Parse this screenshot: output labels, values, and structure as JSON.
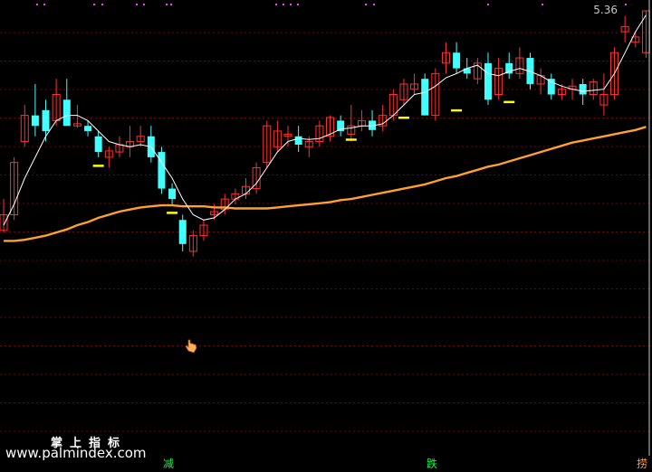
{
  "header": {
    "price_label": "5.36"
  },
  "watermark": {
    "title": "掌上指标",
    "url": "www.palmindex.com"
  },
  "signals": [
    {
      "text": "减",
      "x_index": 14,
      "color": "#00ff40"
    },
    {
      "text": "跌",
      "x_index": 39,
      "color": "#00ff40"
    },
    {
      "text": "捞",
      "x_index": 58,
      "color": "#ffa040"
    }
  ],
  "colors": {
    "up": "#ff3030",
    "down": "#40ffff",
    "ma_short": "#ffffff",
    "ma_long": "#ffa030",
    "marker": "#ffff00",
    "grid": "#7a0000",
    "top_dots": "#ff40ff"
  },
  "chart_data": {
    "type": "candlestick",
    "title": "",
    "xlabel": "",
    "ylabel": "",
    "ylim": [
      2.2,
      5.4
    ],
    "grid": true,
    "candles": [
      [
        3.3,
        3.45,
        3.28,
        3.6
      ],
      [
        3.45,
        3.95,
        3.4,
        4.0
      ],
      [
        4.15,
        4.4,
        4.1,
        4.5
      ],
      [
        4.4,
        4.3,
        4.2,
        4.7
      ],
      [
        4.45,
        4.25,
        4.15,
        4.55
      ],
      [
        4.35,
        4.6,
        4.3,
        4.75
      ],
      [
        4.55,
        4.3,
        4.3,
        4.75
      ],
      [
        4.3,
        4.32,
        4.28,
        4.5
      ],
      [
        4.3,
        4.25,
        4.2,
        4.35
      ],
      [
        4.2,
        4.05,
        4.0,
        4.25
      ],
      [
        4.0,
        4.06,
        3.9,
        4.1
      ],
      [
        4.05,
        4.12,
        4.0,
        4.2
      ],
      [
        4.1,
        4.15,
        4.0,
        4.3
      ],
      [
        4.15,
        4.2,
        4.1,
        4.3
      ],
      [
        4.2,
        4.0,
        3.95,
        4.3
      ],
      [
        4.05,
        3.7,
        3.65,
        4.1
      ],
      [
        3.7,
        3.6,
        3.55,
        3.75
      ],
      [
        3.4,
        3.17,
        3.1,
        3.45
      ],
      [
        3.1,
        3.25,
        3.05,
        3.3
      ],
      [
        3.25,
        3.35,
        3.2,
        3.4
      ],
      [
        3.45,
        3.48,
        3.4,
        3.55
      ],
      [
        3.5,
        3.6,
        3.45,
        3.65
      ],
      [
        3.6,
        3.65,
        3.55,
        3.7
      ],
      [
        3.65,
        3.72,
        3.6,
        3.8
      ],
      [
        3.7,
        3.9,
        3.65,
        3.95
      ],
      [
        3.95,
        4.3,
        3.9,
        4.35
      ],
      [
        4.1,
        4.25,
        4.05,
        4.35
      ],
      [
        4.2,
        4.22,
        4.1,
        4.3
      ],
      [
        4.2,
        4.12,
        4.05,
        4.3
      ],
      [
        4.1,
        4.15,
        4.0,
        4.2
      ],
      [
        4.15,
        4.3,
        4.1,
        4.35
      ],
      [
        4.2,
        4.38,
        4.15,
        4.4
      ],
      [
        4.35,
        4.25,
        4.2,
        4.4
      ],
      [
        4.22,
        4.3,
        4.15,
        4.5
      ],
      [
        4.3,
        4.35,
        4.25,
        4.45
      ],
      [
        4.35,
        4.26,
        4.2,
        4.45
      ],
      [
        4.3,
        4.4,
        4.25,
        4.5
      ],
      [
        4.4,
        4.6,
        4.35,
        4.65
      ],
      [
        4.55,
        4.7,
        4.5,
        4.75
      ],
      [
        4.65,
        4.7,
        4.6,
        4.8
      ],
      [
        4.75,
        4.4,
        4.4,
        4.8
      ],
      [
        4.4,
        4.8,
        4.35,
        4.85
      ],
      [
        4.9,
        5.0,
        4.8,
        5.1
      ],
      [
        5.0,
        4.85,
        4.8,
        5.1
      ],
      [
        4.85,
        4.8,
        4.75,
        4.95
      ],
      [
        4.75,
        4.9,
        4.7,
        4.95
      ],
      [
        4.9,
        4.55,
        4.5,
        5.0
      ],
      [
        4.6,
        4.85,
        4.55,
        4.95
      ],
      [
        4.9,
        4.8,
        4.75,
        5.0
      ],
      [
        4.8,
        4.95,
        4.75,
        5.05
      ],
      [
        4.95,
        4.7,
        4.65,
        5.0
      ],
      [
        4.7,
        4.78,
        4.6,
        4.85
      ],
      [
        4.75,
        4.6,
        4.55,
        4.8
      ],
      [
        4.6,
        4.65,
        4.55,
        4.7
      ],
      [
        4.65,
        4.68,
        4.55,
        4.75
      ],
      [
        4.7,
        4.6,
        4.5,
        4.75
      ],
      [
        4.6,
        4.72,
        4.55,
        4.75
      ],
      [
        4.5,
        4.6,
        4.4,
        4.8
      ],
      [
        4.6,
        5.0,
        4.55,
        5.05
      ],
      [
        5.2,
        5.25,
        5.1,
        5.35
      ],
      [
        5.1,
        5.15,
        5.05,
        5.2
      ],
      [
        5.0,
        5.4,
        4.95,
        5.4
      ]
    ],
    "ma_short": [
      3.35,
      3.55,
      3.8,
      4.0,
      4.2,
      4.35,
      4.4,
      4.4,
      4.35,
      4.25,
      4.15,
      4.12,
      4.1,
      4.12,
      4.1,
      3.95,
      3.8,
      3.6,
      3.45,
      3.4,
      3.42,
      3.5,
      3.6,
      3.65,
      3.75,
      3.9,
      4.05,
      4.15,
      4.18,
      4.17,
      4.18,
      4.22,
      4.27,
      4.28,
      4.3,
      4.3,
      4.32,
      4.4,
      4.5,
      4.6,
      4.62,
      4.68,
      4.76,
      4.8,
      4.85,
      4.88,
      4.8,
      4.78,
      4.82,
      4.85,
      4.82,
      4.78,
      4.72,
      4.68,
      4.65,
      4.63,
      4.64,
      4.65,
      4.8,
      5.0,
      5.2,
      5.36
    ],
    "ma_long": [
      3.2,
      3.2,
      3.21,
      3.23,
      3.25,
      3.28,
      3.31,
      3.35,
      3.38,
      3.42,
      3.45,
      3.48,
      3.5,
      3.52,
      3.53,
      3.54,
      3.54,
      3.53,
      3.53,
      3.53,
      3.52,
      3.52,
      3.51,
      3.51,
      3.51,
      3.51,
      3.52,
      3.53,
      3.54,
      3.55,
      3.56,
      3.57,
      3.59,
      3.6,
      3.62,
      3.64,
      3.66,
      3.68,
      3.7,
      3.72,
      3.74,
      3.77,
      3.8,
      3.82,
      3.85,
      3.88,
      3.91,
      3.93,
      3.96,
      3.99,
      4.02,
      4.05,
      4.08,
      4.11,
      4.14,
      4.16,
      4.18,
      4.2,
      4.22,
      4.24,
      4.26,
      4.29
    ],
    "yellow_markers": [
      {
        "index": 9,
        "value": 3.92
      },
      {
        "index": 16,
        "value": 3.47
      },
      {
        "index": 33,
        "value": 4.17
      },
      {
        "index": 38,
        "value": 4.38
      },
      {
        "index": 43,
        "value": 4.45
      },
      {
        "index": 48,
        "value": 4.53
      }
    ]
  }
}
